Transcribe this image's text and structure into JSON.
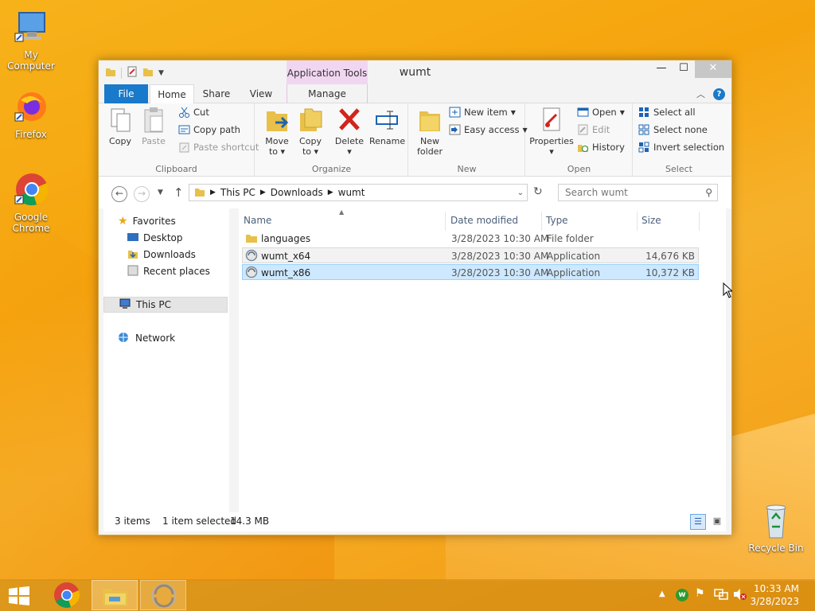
{
  "desktop": {
    "icons": [
      {
        "label": "My Computer"
      },
      {
        "label": "Firefox"
      },
      {
        "label": "Google Chrome"
      },
      {
        "label": "Recycle Bin"
      }
    ]
  },
  "window": {
    "title": "wumt",
    "contextual_tab_group": "Application Tools",
    "tabs": {
      "file": "File",
      "home": "Home",
      "share": "Share",
      "view": "View",
      "manage": "Manage"
    },
    "ribbon": {
      "clipboard": {
        "label": "Clipboard",
        "copy": "Copy",
        "paste": "Paste",
        "cut": "Cut",
        "copy_path": "Copy path",
        "paste_shortcut": "Paste shortcut"
      },
      "organize": {
        "label": "Organize",
        "move_to": "Move",
        "move_to2": "to",
        "copy_to": "Copy",
        "copy_to2": "to",
        "delete": "Delete",
        "rename": "Rename"
      },
      "new": {
        "label": "New",
        "new_folder": "New",
        "new_folder2": "folder",
        "new_item": "New item",
        "easy_access": "Easy access"
      },
      "open": {
        "label": "Open",
        "properties": "Properties",
        "open": "Open",
        "edit": "Edit",
        "history": "History"
      },
      "select": {
        "label": "Select",
        "select_all": "Select all",
        "select_none": "Select none",
        "invert": "Invert selection"
      }
    },
    "address": {
      "crumbs": [
        "This PC",
        "Downloads",
        "wumt"
      ],
      "search_placeholder": "Search wumt"
    },
    "nav": {
      "favorites": "Favorites",
      "desktop": "Desktop",
      "downloads": "Downloads",
      "recent": "Recent places",
      "this_pc": "This PC",
      "network": "Network"
    },
    "columns": {
      "name": "Name",
      "date": "Date modified",
      "type": "Type",
      "size": "Size"
    },
    "files": [
      {
        "name": "languages",
        "date": "3/28/2023 10:30 AM",
        "type": "File folder",
        "size": ""
      },
      {
        "name": "wumt_x64",
        "date": "3/28/2023 10:30 AM",
        "type": "Application",
        "size": "14,676 KB"
      },
      {
        "name": "wumt_x86",
        "date": "3/28/2023 10:30 AM",
        "type": "Application",
        "size": "10,372 KB"
      }
    ],
    "status": {
      "items": "3 items",
      "selected": "1 item selected",
      "size": "14.3 MB"
    }
  },
  "taskbar": {
    "time": "10:33 AM",
    "date": "3/28/2023"
  }
}
